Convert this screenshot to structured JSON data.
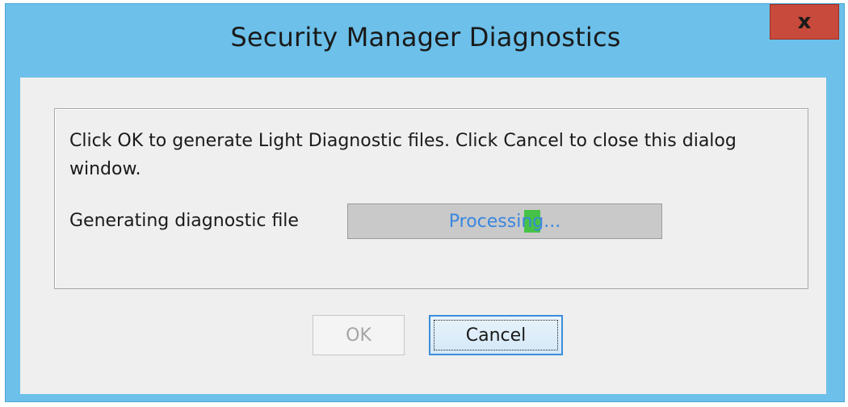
{
  "window": {
    "title": "Security Manager Diagnostics",
    "close_glyph": "x",
    "accent_color": "#6cc0ea",
    "close_color": "#c74a3c"
  },
  "dialog": {
    "message": "Click OK to generate Light Diagnostic files. Click Cancel to close this dialog window.",
    "progress_label": "Generating diagnostic file",
    "progress_text": "Processing..."
  },
  "buttons": {
    "ok_label": "OK",
    "ok_enabled": false,
    "cancel_label": "Cancel",
    "cancel_focused": true
  },
  "icons": {
    "close": "close-icon"
  }
}
